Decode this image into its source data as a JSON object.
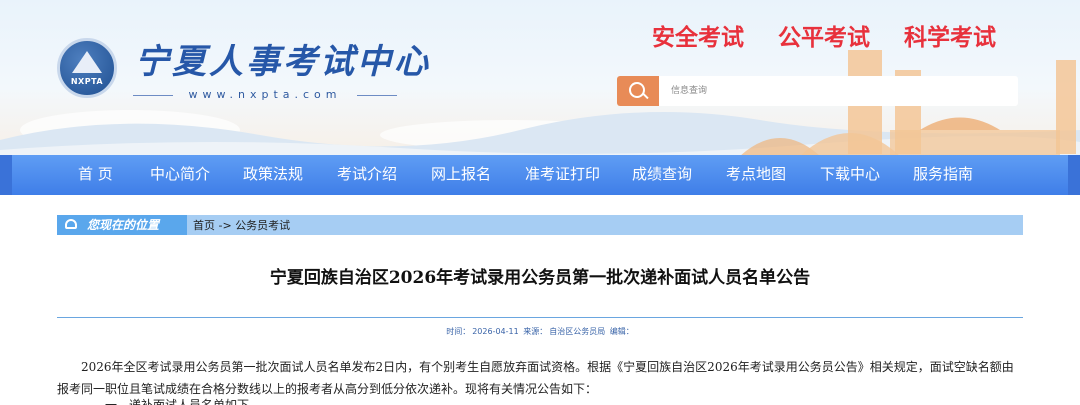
{
  "header": {
    "logo_text": "NXPTA",
    "site_title": "宁夏人事考试中心",
    "site_url": "www.nxpta.com",
    "slogans": [
      "安全考试",
      "公平考试",
      "科学考试"
    ],
    "search_placeholder": "信息查询"
  },
  "nav": {
    "items": [
      "首 页",
      "中心简介",
      "政策法规",
      "考试介绍",
      "网上报名",
      "准考证打印",
      "成绩查询",
      "考点地图",
      "下载中心",
      "服务指南"
    ]
  },
  "breadcrumb": {
    "label": "您现在的位置",
    "home": "首页",
    "separator": "->",
    "current": "公务员考试"
  },
  "article": {
    "title": "宁夏回族自治区2026年考试录用公务员第一批次递补面试人员名单公告",
    "meta_time_label": "时间：",
    "meta_time": "2026-04-11",
    "meta_source_label": "来源：",
    "meta_source": "自治区公务员局",
    "meta_editor_label": "编辑：",
    "paragraph": "2026年全区考试录用公务员第一批次面试人员名单发布2日内，有个别考生自愿放弃面试资格。根据《宁夏回族自治区2026年考试录用公务员公告》相关规定，面试空缺名额由报考同一职位且笔试成绩在合格分数线以上的报考者从高分到低分依次递补。现将有关情况公告如下：",
    "paragraph2": "一、递补面试人员名单如下"
  },
  "colors": {
    "nav_bg": "#4a88ee",
    "slogan": "#e8313c",
    "search_button": "#e88b57",
    "breadcrumb_bg": "#a6cdf3",
    "title_blue": "#2657a8"
  }
}
